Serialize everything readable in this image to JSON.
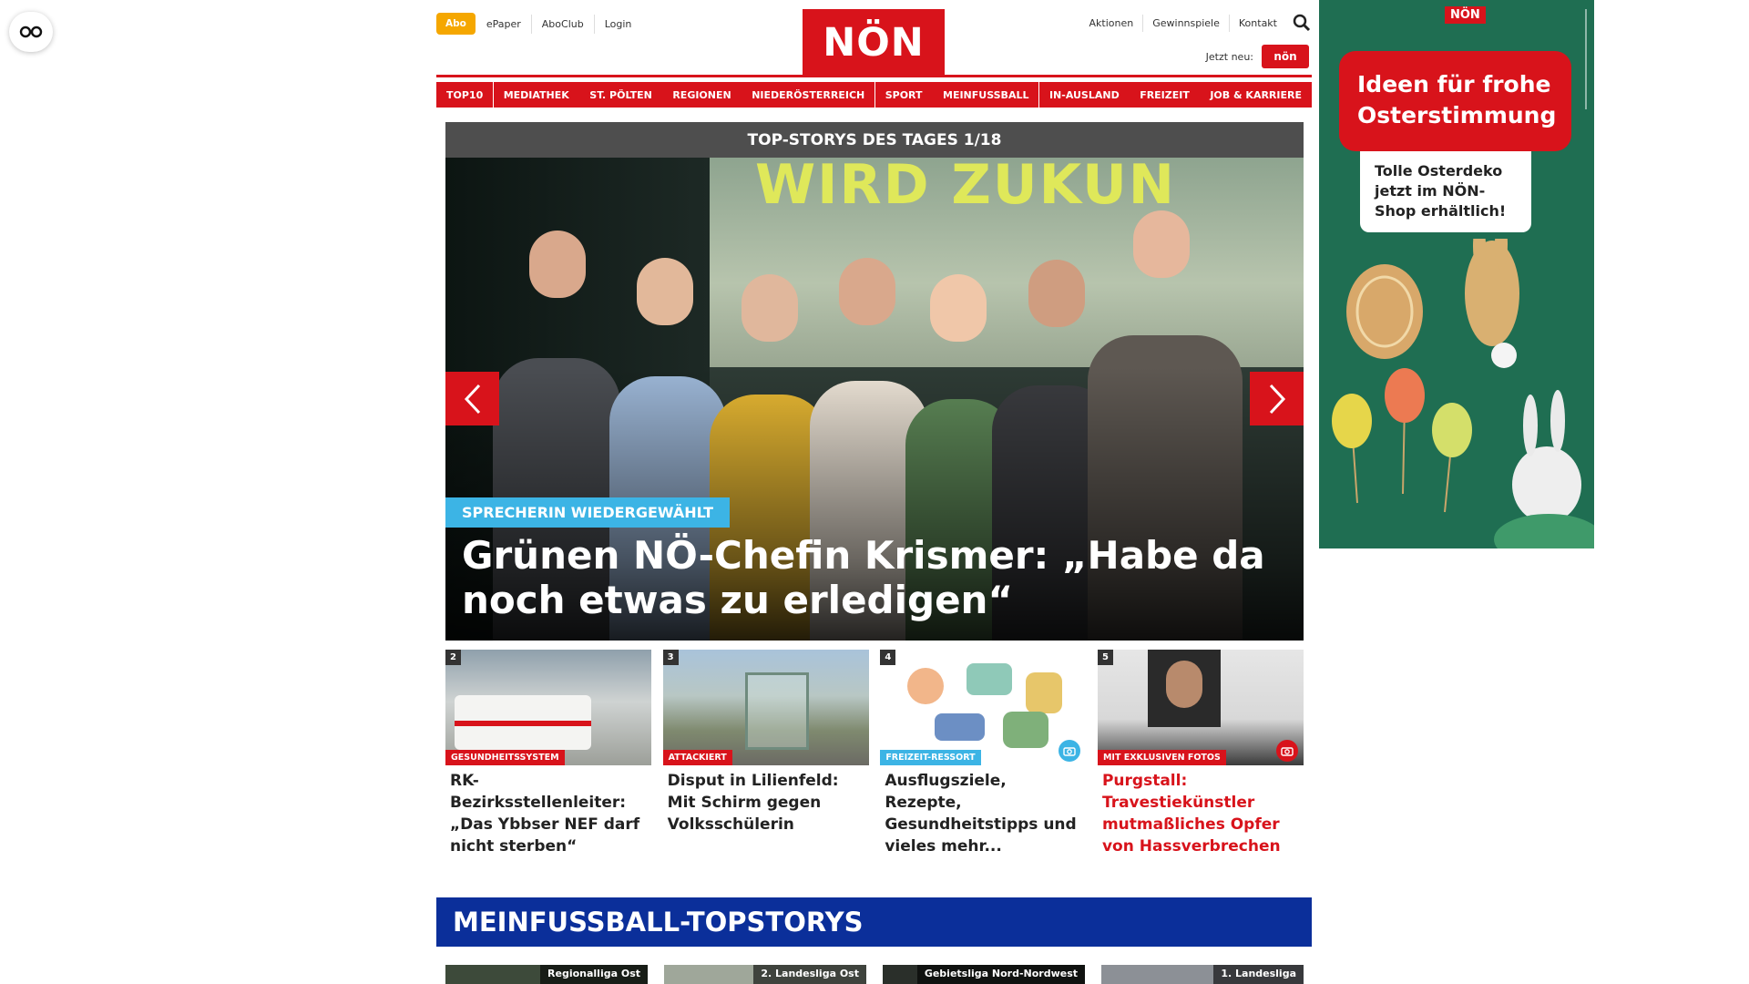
{
  "reader_icon": "glasses-icon",
  "top_links": {
    "abo": "Abo",
    "items": [
      "ePaper",
      "AboClub",
      "Login"
    ]
  },
  "logo": "NÖN",
  "right_links": [
    "Aktionen",
    "Gewinnspiele",
    "Kontakt"
  ],
  "jetzt_neu": {
    "label": "Jetzt neu:",
    "brand": "nön"
  },
  "main_nav": [
    "TOP10",
    "MEDIATHEK",
    "ST. PÖLTEN",
    "REGIONEN",
    "NIEDERÖSTERREICH",
    "SPORT",
    "MEINFUSSBALL",
    "IN-AUSLAND",
    "FREIZEIT",
    "JOB & KARRIERE"
  ],
  "slider": {
    "heading": "TOP-STORYS DES TAGES 1/18",
    "screen_text": "WIRD ZUKUN",
    "tag": "SPRECHERIN WIEDERGEWÄHLT",
    "title": "Grünen NÖ-Chefin Krismer: „Habe da noch etwas zu erledigen“"
  },
  "teasers": [
    {
      "num": "2",
      "category": "GESUNDHEITSSYSTEM",
      "title": "RK-Bezirksstellenleiter: „Das Ybbser NEF darf nicht sterben“"
    },
    {
      "num": "3",
      "category": "ATTACKIERT",
      "title": "Disput in Lilienfeld: Mit Schirm gegen Volksschülerin"
    },
    {
      "num": "4",
      "category": "FREIZEIT-RESSORT",
      "title": "Ausflugsziele, Rezepte, Gesundheitstipps und vieles mehr..."
    },
    {
      "num": "5",
      "category": "MIT EXKLUSIVEN FOTOS",
      "title": "Purgstall: Travestiekünstler mutmaßliches Opfer von Hassverbrechen"
    }
  ],
  "fussball": {
    "heading": "MEINFUSSBALL-TOPSTORYS",
    "leagues": [
      "Regionalliga Ost",
      "2. Landesliga Ost",
      "Gebietsliga Nord-Nordwest",
      "1. Landesliga"
    ]
  },
  "ad": {
    "brand": "NÖN",
    "headline": "Ideen für frohe Osterstimmung",
    "note": "Tolle Osterdeko jetzt im NÖN-Shop erhältlich!"
  },
  "colors": {
    "brand_red": "#d8131b",
    "abo_orange": "#f5a700",
    "tag_blue": "#3cb4e5",
    "fussball_blue": "#0b2f9a",
    "ad_green": "#1f6e52"
  }
}
